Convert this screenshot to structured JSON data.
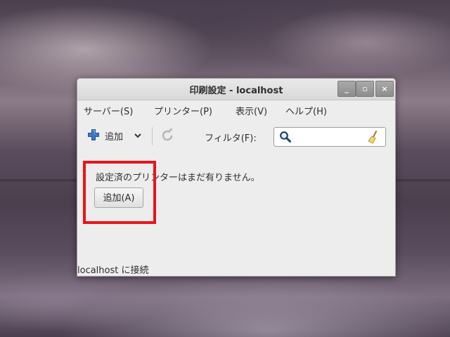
{
  "window": {
    "title": "印刷設定 - localhost",
    "minimize_symbol": "_",
    "maximize_symbol": "▫",
    "close_symbol": "×"
  },
  "menu": {
    "items": [
      "サーバー(S)",
      "プリンター(P)",
      "表示(V)",
      "ヘルプ(H)"
    ]
  },
  "toolbar": {
    "add_label": "追加",
    "add_icon": "plus-icon",
    "dropdown_icon": "chevron-down-icon",
    "refresh_icon": "refresh-icon",
    "filter_label": "フィルタ(F):",
    "search_value": "",
    "search_icon": "magnifier-icon",
    "clear_icon": "broom-icon"
  },
  "content": {
    "empty_message": "設定済のプリンターはまだ有りません。",
    "add_button_label": "追加(A)"
  },
  "status": {
    "text": "localhost に接続"
  },
  "colors": {
    "highlight": "#e8151b",
    "plus_blue": "#3b78c9"
  }
}
